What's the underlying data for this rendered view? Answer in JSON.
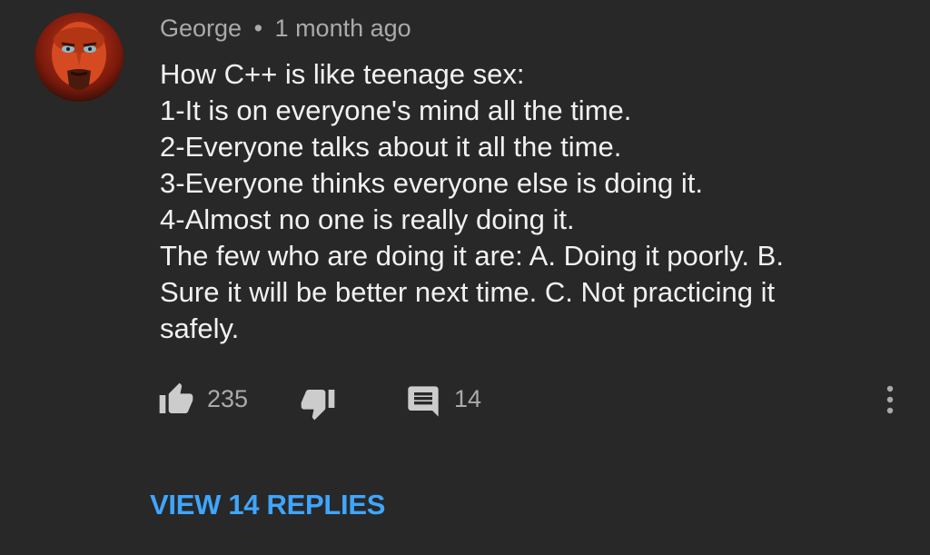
{
  "comment": {
    "author": "George",
    "separator": "•",
    "timestamp": "1 month ago",
    "lines": [
      "How C++ is like teenage sex:",
      "1-It is on everyone's mind all the time.",
      "2-Everyone talks about it all the time.",
      "3-Everyone thinks everyone else is doing it.",
      "4-Almost no one is really doing it.",
      "The few who are doing it are: A. Doing it poorly. B.",
      "Sure it will be better next time. C. Not practicing it",
      "safely."
    ]
  },
  "actions": {
    "like_icon": "thumbs-up-icon",
    "like_count": "235",
    "dislike_icon": "thumbs-down-icon",
    "reply_icon": "comment-icon",
    "reply_count": "14",
    "more_icon": "more-vertical-icon"
  },
  "replies": {
    "label": "VIEW 14 REPLIES"
  },
  "colors": {
    "background": "#282828",
    "text_primary": "#f1f1f1",
    "text_secondary": "#aaaaaa",
    "link": "#3ea6ff"
  }
}
